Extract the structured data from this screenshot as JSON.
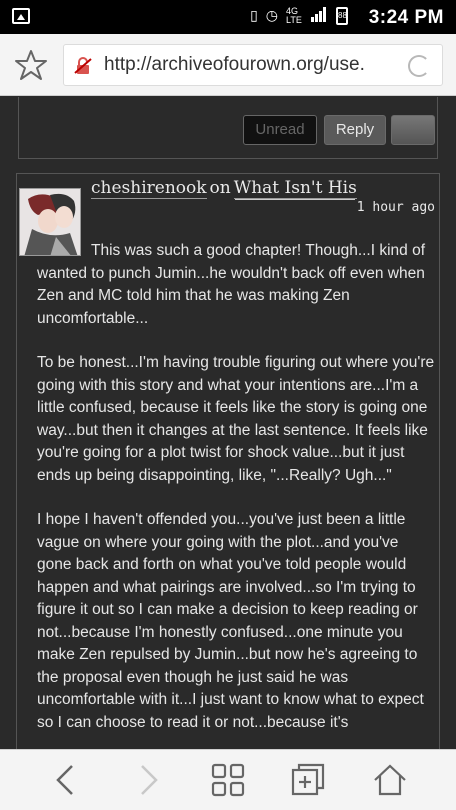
{
  "status_bar": {
    "time": "3:24 PM",
    "network": "4G LTE",
    "battery_level": "88"
  },
  "address_bar": {
    "url": "http://archiveofourown.org/use."
  },
  "previous_comment": {
    "buttons": {
      "unread": "Unread",
      "reply": "Reply"
    }
  },
  "comment": {
    "author": "cheshirenook",
    "on_word": "on",
    "work_title": "What Isn't His",
    "timestamp": "1 hour ago",
    "paragraphs": [
      "This was such a good chapter! Though...I kind of wanted to punch Jumin...he wouldn't back off even when Zen and MC told him that he was making Zen uncomfortable...",
      "To be honest...I'm having trouble figuring out where you're going with this story and what your intentions are...I'm a little confused, because it feels like the story is going one way...but then it changes at the last sentence. It feels like you're going for a plot twist for shock value...but it just ends up being disappointing, like, \"...Really? Ugh...\"",
      "I hope I haven't offended you...you've just been a little vague on where your going with the plot...and you've gone back and forth on what you've told people would happen and what pairings are involved...so I'm trying to figure it out so I can make a decision to keep reading or not...because I'm honestly confused...one minute you make Zen repulsed by Jumin...but now he's agreeing to the proposal even though he just said he was uncomfortable with it...I just want to know what to expect so I can choose to read it or not...because it's"
    ]
  },
  "icons": {
    "favorite": "star-icon",
    "security": "broken-lock-icon",
    "reload": "reload-icon",
    "back": "chevron-left-icon",
    "forward": "chevron-right-icon",
    "tabs": "tabs-grid-icon",
    "new_tab": "new-tab-icon",
    "home": "home-icon"
  },
  "colors": {
    "page_background": "#2a2a2a",
    "text": "#e6e6e6",
    "browser_chrome": "#f4f4f4"
  }
}
